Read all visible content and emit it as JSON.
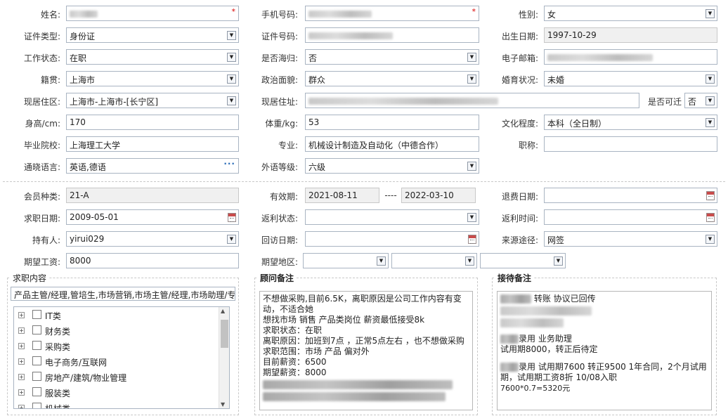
{
  "basic": {
    "name_label": "姓名:",
    "phone_label": "手机号码:",
    "gender_label": "性别:",
    "gender_value": "女",
    "id_type_label": "证件类型:",
    "id_type_value": "身份证",
    "id_no_label": "证件号码:",
    "birth_label": "出生日期:",
    "birth_value": "1997-10-29",
    "work_status_label": "工作状态:",
    "work_status_value": "在职",
    "overseas_label": "是否海归:",
    "overseas_value": "否",
    "email_label": "电子邮箱:",
    "native_label": "籍贯:",
    "native_value": "上海市",
    "political_label": "政治面貌:",
    "political_value": "群众",
    "marital_label": "婚育状况:",
    "marital_value": "未婚",
    "residence_label": "现居住区:",
    "residence_value": "上海市-上海市-[长宁区]",
    "address_label": "现居住址:",
    "relocate_label": "是否可迁",
    "relocate_value": "否",
    "height_label": "身高/cm:",
    "height_value": "170",
    "weight_label": "体重/kg:",
    "weight_value": "53",
    "education_label": "文化程度:",
    "education_value": "本科（全日制）",
    "school_label": "毕业院校:",
    "school_value": "上海理工大学",
    "major_label": "专业:",
    "major_value": "机械设计制造及自动化（中德合作）",
    "title_label": "职称:",
    "title_value": "",
    "languages_label": "通晓语言:",
    "languages_value": "英语,德语",
    "lang_level_label": "外语等级:",
    "lang_level_value": "六级"
  },
  "membership": {
    "member_type_label": "会员种类:",
    "member_type_value": "21-A",
    "validity_label": "有效期:",
    "validity_from": "2021-08-11",
    "validity_sep": "----",
    "validity_to": "2022-03-10",
    "refund_date_label": "退费日期:",
    "refund_date_value": "",
    "job_date_label": "求职日期:",
    "job_date_value": "2009-05-01",
    "rebate_status_label": "返利状态:",
    "rebate_status_value": "",
    "rebate_time_label": "返利时间:",
    "rebate_time_value": "",
    "holder_label": "持有人:",
    "holder_value": "yirui029",
    "visit_date_label": "回访日期:",
    "visit_date_value": "",
    "source_label": "来源途径:",
    "source_value": "网签",
    "salary_label": "期望工资:",
    "salary_value": "8000",
    "region_label": "期望地区:"
  },
  "job_content": {
    "title": "求职内容",
    "summary": "产品主管/经理,管培生,市场营销,市场主管/经理,市场助理/专",
    "categories": [
      "IT类",
      "财务类",
      "采购类",
      "电子商务/互联网",
      "房地产/建筑/物业管理",
      "服装类",
      "机械类"
    ]
  },
  "advisor_notes": {
    "title": "顾问备注",
    "lines": [
      "不想做采购,目前6.5K，离职原因是公司工作内容有变",
      "动，不适合她",
      "想找市场  销售  产品类岗位  薪资最低接受8k",
      "求职状态：在职",
      "离职原因：加班到7点 ，正常5点左右 ，也不想做采购",
      "求职范围：市场  产品  偏对外",
      "目前薪资：6500",
      "期望薪资：8000"
    ]
  },
  "reception_notes": {
    "title": "接待备注",
    "line1": "转账  协议已回传",
    "line2a": "录用  业务助理",
    "line2b": "试用期8000，转正后待定",
    "line3a": "录用     试用期7600  转正9500  1年合同，2个月试用",
    "line3b": "期，试用期工资8折   10/08入职",
    "line3c": "7600*0.7=5320元"
  },
  "icons": {
    "dropdown": "chevron-down-icon",
    "calendar": "calendar-icon",
    "more": "ellipsis-icon",
    "required": "asterisk-icon",
    "expand": "plus-icon",
    "scroll_up": "caret-up-icon",
    "scroll_down": "caret-down-icon"
  },
  "colors": {
    "required": "#d80000",
    "field_border": "#a9b4c2",
    "readonly_bg": "#f0f0f0",
    "ellipsis": "#2b6cb8"
  }
}
